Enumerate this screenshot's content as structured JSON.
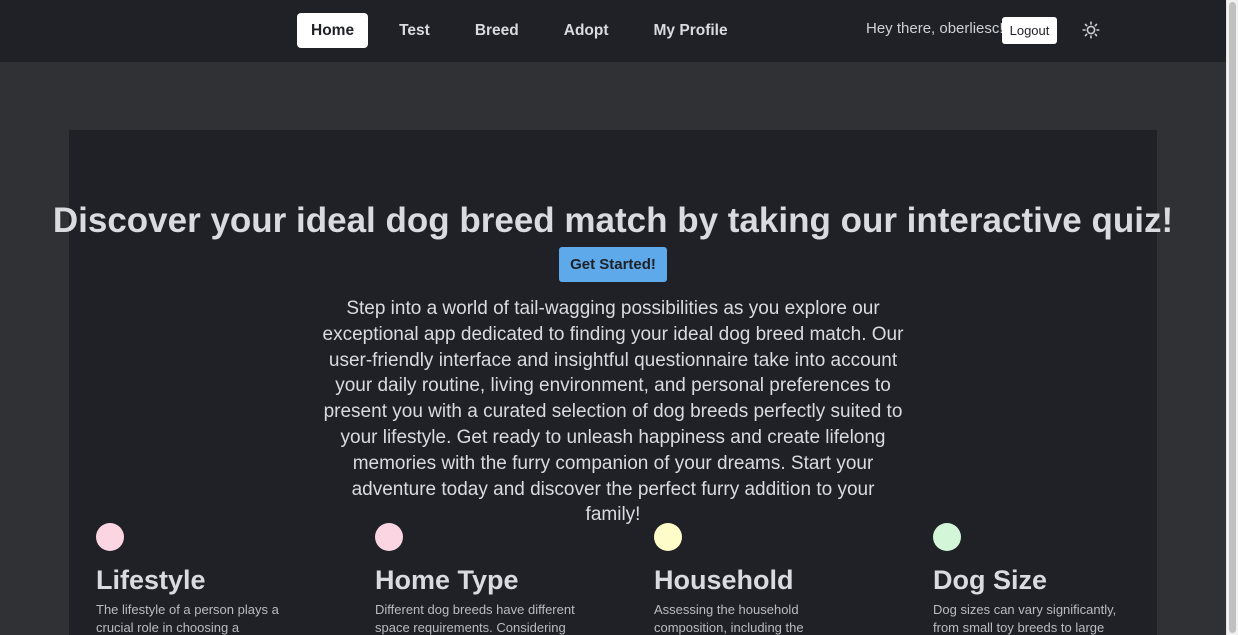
{
  "nav": {
    "links": [
      "Home",
      "Test",
      "Breed",
      "Adopt",
      "My Profile"
    ],
    "greeting": "Hey there, oberliesc!",
    "logout_label": "Logout",
    "theme_icon": "sun-icon"
  },
  "hero": {
    "title": "Discover your ideal dog breed match by taking our interactive quiz!",
    "cta_label": "Get Started!",
    "intro": "Step into a world of tail-wagging possibilities as you explore our exceptional app dedicated to finding your ideal dog breed match. Our user-friendly interface and insightful questionnaire take into account your daily routine, living environment, and personal preferences to present you with a curated selection of dog breeds perfectly suited to your lifestyle. Get ready to unleash happiness and create lifelong memories with the furry companion of your dreams. Start your adventure today and discover the perfect furry addition to your family!"
  },
  "features": [
    {
      "title": "Lifestyle",
      "text": "The lifestyle of a person plays a crucial role in choosing a",
      "color": "#fcd5e3"
    },
    {
      "title": "Home Type",
      "text": "Different dog breeds have different space requirements. Considering",
      "color": "#fcd5e3"
    },
    {
      "title": "Household",
      "text": "Assessing the household composition, including the",
      "color": "#fefcc8"
    },
    {
      "title": "Dog Size",
      "text": "Dog sizes can vary significantly, from small toy breeds to large",
      "color": "#d3f6d9"
    }
  ],
  "colors": {
    "background": "#2f3134",
    "surface": "#1f2126",
    "accent": "#5ea9e9"
  }
}
